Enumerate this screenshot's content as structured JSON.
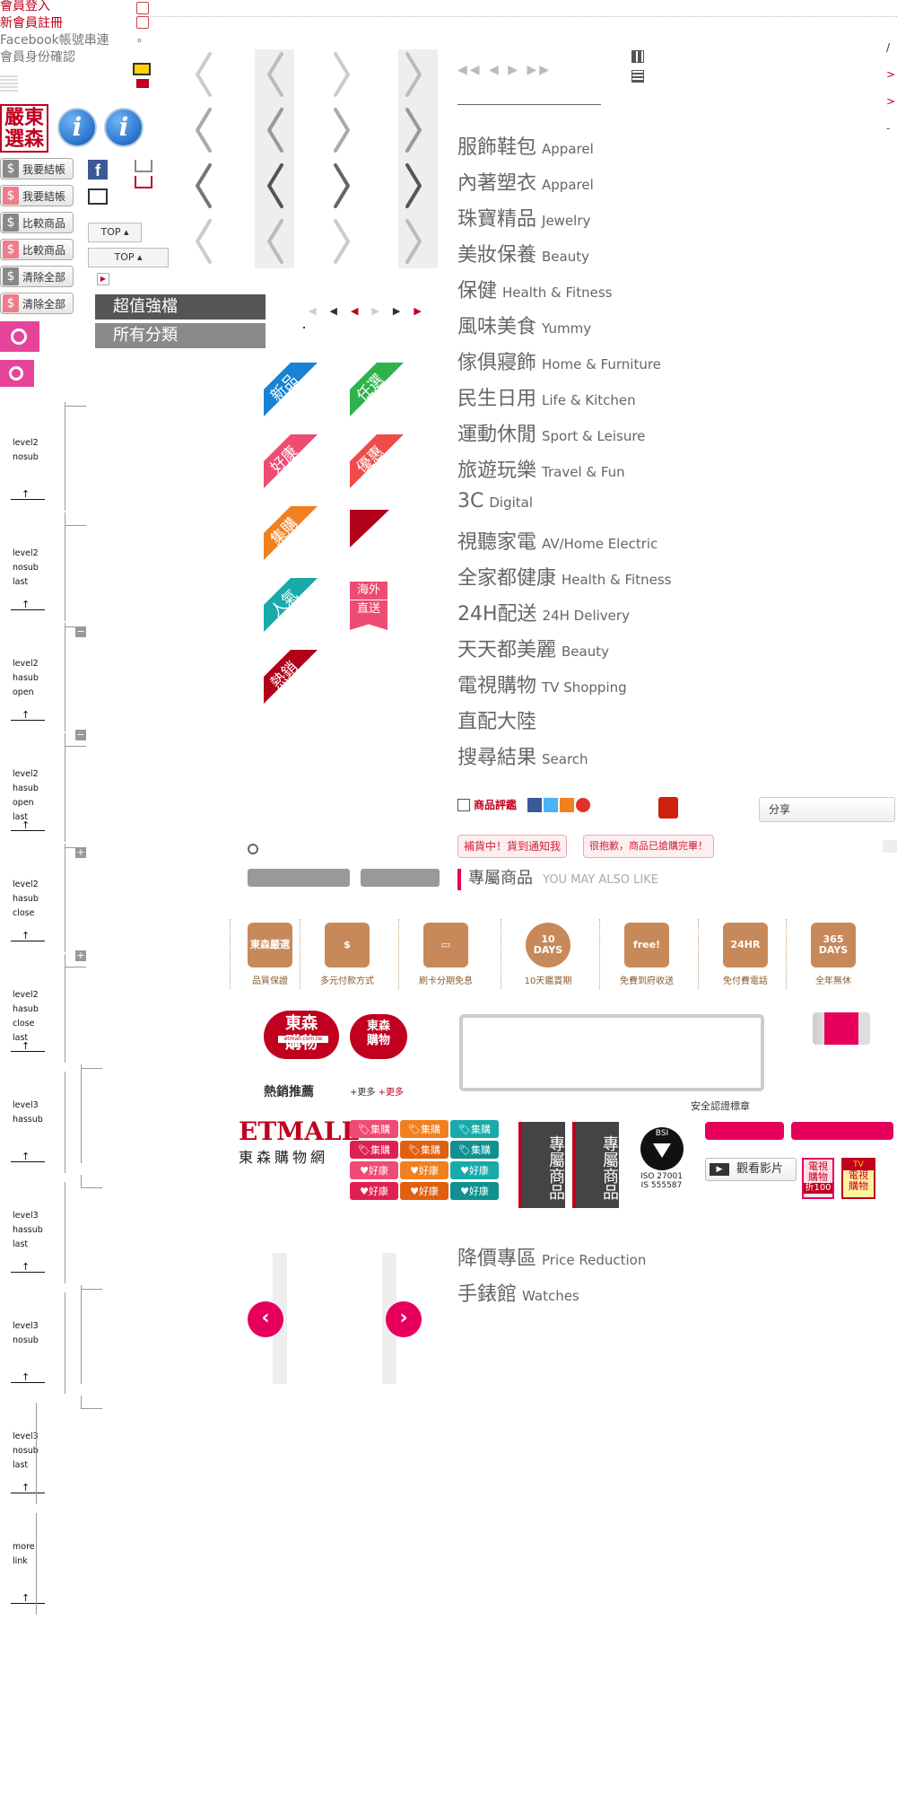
{
  "member": {
    "login": "會員登入",
    "register": "新會員註冊",
    "facebook": "Facebook帳號串連",
    "verify": "會員身份確認",
    "dot": "。"
  },
  "logo_seal": "嚴東選森",
  "side_buttons": [
    {
      "label": "我要結帳",
      "icon_color": "#888"
    },
    {
      "label": "我要結帳",
      "icon_color": "#f07b8a"
    },
    {
      "label": "比較商品",
      "icon_color": "#888"
    },
    {
      "label": "比較商品",
      "icon_color": "#f07b8a"
    },
    {
      "label": "清除全部",
      "icon_color": "#888"
    },
    {
      "label": "清除全部",
      "icon_color": "#f07b8a"
    }
  ],
  "top_buttons": [
    "TOP",
    "TOP"
  ],
  "menu_bar": [
    "超值強檔",
    "所有分類"
  ],
  "ribbons": [
    "新品",
    "任選",
    "好康",
    "優惠",
    "集購",
    "",
    "人氣",
    "熱銷"
  ],
  "overseas": {
    "line1": "海外",
    "line2": "直送"
  },
  "categories": [
    {
      "zh": "服飾鞋包",
      "en": "Apparel"
    },
    {
      "zh": "內著塑衣",
      "en": "Apparel"
    },
    {
      "zh": "珠寶精品",
      "en": "Jewelry"
    },
    {
      "zh": "美妝保養",
      "en": "Beauty"
    },
    {
      "zh": "保健",
      "en": "Health & Fitness"
    },
    {
      "zh": "風味美食",
      "en": "Yummy"
    },
    {
      "zh": "傢俱寢飾",
      "en": "Home & Furniture"
    },
    {
      "zh": "民生日用",
      "en": "Life & Kitchen"
    },
    {
      "zh": "運動休閒",
      "en": "Sport & Leisure"
    },
    {
      "zh": "旅遊玩樂",
      "en": "Travel & Fun"
    },
    {
      "zh": "3C",
      "en": "Digital"
    },
    {
      "zh": "視聽家電",
      "en": "AV/Home Electric"
    },
    {
      "zh": "全家都健康",
      "en": "Health & Fitness"
    },
    {
      "zh": "24H配送",
      "en": "24H Delivery"
    },
    {
      "zh": "天天都美麗",
      "en": "Beauty"
    },
    {
      "zh": "電視購物",
      "en": "TV Shopping"
    },
    {
      "zh": "直配大陸",
      "en": ""
    },
    {
      "zh": "搜尋結果",
      "en": "Search"
    }
  ],
  "categories2": [
    {
      "zh": "降價專區",
      "en": "Price Reduction"
    },
    {
      "zh": "手錶館",
      "en": "Watches"
    }
  ],
  "review": {
    "label": "商品評鑑",
    "share": "分享"
  },
  "notices": {
    "restock": "補貨中！貨到通知我",
    "soldout": "很抱歉，商品已搶購完畢！"
  },
  "exclusive": {
    "zh": "專屬商品",
    "en": "YOU MAY ALSO LIKE"
  },
  "services": [
    "品質保證",
    "多元付款方式",
    "刷卡分期免息",
    "10天鑑賞期",
    "免費到府收送",
    "免付費電話",
    "全年無休"
  ],
  "service_icons": {
    "seal": "東森嚴選",
    "days10": "10",
    "days_word": "DAYS",
    "free": "free!",
    "hr24": "24HR",
    "d365": "365",
    "days365": "DAYS"
  },
  "hot": {
    "label": "熱銷推薦",
    "brand_top": "東森",
    "brand_bottom": "購物",
    "site": "etmall.com.tw",
    "more1": "更多",
    "more2": "更多"
  },
  "security": "安全認證標章",
  "etmall": {
    "name": "ETMALL",
    "sub": "東森購物網"
  },
  "tags": {
    "group": "集購",
    "good": "好康"
  },
  "vertical_banner": "專屬商品",
  "bsi": {
    "name": "BSI",
    "iso": "ISO 27001",
    "is": "IS 555587"
  },
  "video": "觀看影片",
  "tv_badge": {
    "line1": "電視",
    "line2": "購物",
    "discount": "折100",
    "tv": "TV"
  },
  "right_edge": [
    "/",
    ">",
    ">",
    "-"
  ],
  "tree": [
    {
      "lines": [
        "level2",
        "nosub"
      ]
    },
    {
      "lines": [
        "level2",
        "nosub",
        "last"
      ]
    },
    {
      "lines": [
        "level2",
        "hasub",
        "open"
      ]
    },
    {
      "lines": [
        "level2",
        "hasub",
        "open",
        "last"
      ]
    },
    {
      "lines": [
        "level2",
        "hasub",
        "close"
      ]
    },
    {
      "lines": [
        "level2",
        "hasub",
        "close",
        "last"
      ]
    },
    {
      "lines": [
        "level3",
        "hassub"
      ]
    },
    {
      "lines": [
        "level3",
        "hassub",
        "last"
      ]
    },
    {
      "lines": [
        "level3",
        "nosub"
      ]
    },
    {
      "lines": [
        "level3",
        "nosub",
        "last"
      ]
    },
    {
      "lines": [
        "more",
        "link"
      ]
    }
  ],
  "tree_arrow": "↑",
  "tree_icons": {
    "minus": "−",
    "plus": "+"
  },
  "colors": {
    "brand_red": "#c0001e",
    "pink": "#e6005c",
    "magenta_search": "#e6449b",
    "dark_bar": "#555555",
    "ribbon_blue": "#1a82d2",
    "ribbon_green": "#2db34a",
    "ribbon_pink": "#ef4b73",
    "ribbon_orange": "#f08020",
    "ribbon_teal": "#18aaaa"
  }
}
